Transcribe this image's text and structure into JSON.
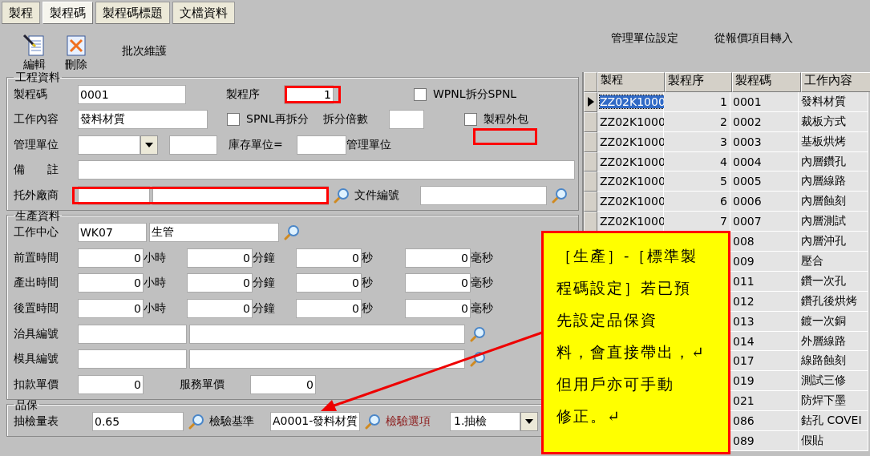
{
  "tabs": [
    {
      "label": "製程",
      "selected": false
    },
    {
      "label": "製程碼",
      "selected": true
    },
    {
      "label": "製程碼標題",
      "selected": false
    },
    {
      "label": "文檔資料",
      "selected": false
    }
  ],
  "toolbar": {
    "edit": "編輯",
    "delete": "刪除",
    "batch": "批次維護",
    "unit_setup": "管理單位設定",
    "import": "從報價項目轉入"
  },
  "engineering": {
    "title": "工程資料",
    "code_label": "製程碼",
    "code": "0001",
    "seq_label": "製程序",
    "seq": "1",
    "wpnl": {
      "label": "WPNL拆分SPNL",
      "checked": false
    },
    "content_label": "工作內容",
    "content": "發料材質",
    "spnl": {
      "label": "SPNL再拆分",
      "checked": false
    },
    "multiple_label": "拆分倍數",
    "outsource": {
      "label": "製程外包",
      "checked": false
    },
    "unit_label": "管理單位",
    "stock_unit_label": "庫存單位=",
    "unit_suffix": "管理單位",
    "remark_label": "備　　註",
    "vendor_label": "托外廠商",
    "doc_label": "文件編號"
  },
  "production": {
    "title": "生產資料",
    "center_label": "工作中心",
    "center_code": "WK07",
    "center_name": "生管",
    "times": [
      {
        "label": "前置時間",
        "fields": [
          {
            "value": "0",
            "unit": "小時"
          },
          {
            "value": "0",
            "unit": "分鐘"
          },
          {
            "value": "0",
            "unit": "秒"
          },
          {
            "value": "0",
            "unit": "毫秒"
          }
        ]
      },
      {
        "label": "產出時間",
        "fields": [
          {
            "value": "0",
            "unit": "小時"
          },
          {
            "value": "0",
            "unit": "分鐘"
          },
          {
            "value": "0",
            "unit": "秒"
          },
          {
            "value": "0",
            "unit": "毫秒"
          }
        ]
      },
      {
        "label": "後置時間",
        "fields": [
          {
            "value": "0",
            "unit": "小時"
          },
          {
            "value": "0",
            "unit": "分鐘"
          },
          {
            "value": "0",
            "unit": "秒"
          },
          {
            "value": "0",
            "unit": "毫秒"
          }
        ]
      }
    ],
    "jig_label": "治具編號",
    "mold_label": "模具編號",
    "deduct_label": "扣款單價",
    "deduct": "0",
    "service_label": "服務單價",
    "service": "0"
  },
  "qc": {
    "title": "品保",
    "table_label": "抽檢量表",
    "table": "0.65",
    "std_label": "檢驗基準",
    "std": "A0001-發料材質",
    "option_label": "檢驗選項",
    "option": "1.抽檢"
  },
  "grid": {
    "columns": [
      "製程",
      "製程序",
      "製程碼",
      "工作內容"
    ],
    "rows": [
      {
        "process": "ZZ02K1000",
        "seq": "1",
        "code": "0001",
        "content": "發料材質",
        "selected": true
      },
      {
        "process": "ZZ02K1000",
        "seq": "2",
        "code": "0002",
        "content": "裁板方式",
        "selected": false
      },
      {
        "process": "ZZ02K1000",
        "seq": "3",
        "code": "0003",
        "content": "基板烘烤",
        "selected": false
      },
      {
        "process": "ZZ02K1000",
        "seq": "4",
        "code": "0004",
        "content": "內層鑽孔",
        "selected": false
      },
      {
        "process": "ZZ02K1000",
        "seq": "5",
        "code": "0005",
        "content": "內層線路",
        "selected": false
      },
      {
        "process": "ZZ02K1000",
        "seq": "6",
        "code": "0006",
        "content": "內層蝕刻",
        "selected": false
      },
      {
        "process": "ZZ02K1000",
        "seq": "7",
        "code": "0007",
        "content": "內層測試",
        "selected": false
      },
      {
        "code": "008",
        "content": "內層沖孔"
      },
      {
        "code": "009",
        "content": "壓合"
      },
      {
        "code": "011",
        "content": "鑽一次孔"
      },
      {
        "code": "012",
        "content": "鑽孔後烘烤"
      },
      {
        "code": "013",
        "content": "鍍一次銅"
      },
      {
        "code": "014",
        "content": "外層線路"
      },
      {
        "code": "017",
        "content": "線路蝕刻"
      },
      {
        "code": "019",
        "content": "測試三修"
      },
      {
        "code": "021",
        "content": "防焊下墨"
      },
      {
        "code": "086",
        "content": "鈷孔 COVEI"
      },
      {
        "code": "089",
        "content": "假貼"
      }
    ]
  },
  "callout": {
    "lines": [
      "［生產］-［標準製",
      "程碼設定］若已預",
      "先設定品保資",
      "料，會直接帶出，↵",
      "但用戶亦可手動",
      "修正。↵"
    ]
  }
}
